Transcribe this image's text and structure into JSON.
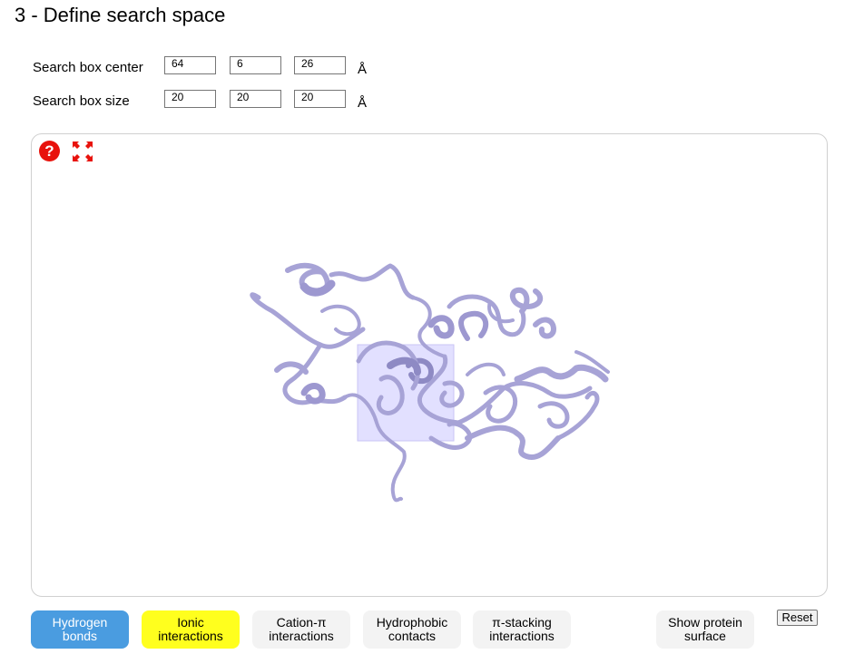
{
  "section_title": "3 - Define search space",
  "search_box": {
    "center_label": "Search box center",
    "center": [
      "64",
      "6",
      "26"
    ],
    "size_label": "Search box size",
    "size": [
      "20",
      "20",
      "20"
    ],
    "unit": "Å"
  },
  "viewer": {
    "help_icon": "help-icon",
    "fullscreen_icon": "fullscreen-icon",
    "help_glyph": "?",
    "protein_color": "#a7a3d6",
    "box_color": "#dcd9ff"
  },
  "buttons": {
    "hydrogen_bonds": {
      "line1": "Hydrogen",
      "line2": "bonds",
      "bg": "#4a9ce0",
      "fg": "#ffffff"
    },
    "ionic": {
      "line1": "Ionic",
      "line2": "interactions",
      "bg": "#ffff1e",
      "fg": "#000000"
    },
    "cation_pi": {
      "line1": "Cation-π",
      "line2": "interactions",
      "bg": "#f3f3f3",
      "fg": "#000000"
    },
    "hydrophobic": {
      "line1": "Hydrophobic",
      "line2": "contacts",
      "bg": "#f3f3f3",
      "fg": "#000000"
    },
    "pi_stacking": {
      "line1": "π-stacking",
      "line2": "interactions",
      "bg": "#f3f3f3",
      "fg": "#000000"
    },
    "surface": {
      "line1": "Show protein",
      "line2": "surface",
      "bg": "#f3f3f3",
      "fg": "#000000"
    }
  },
  "reset_label": "Reset"
}
